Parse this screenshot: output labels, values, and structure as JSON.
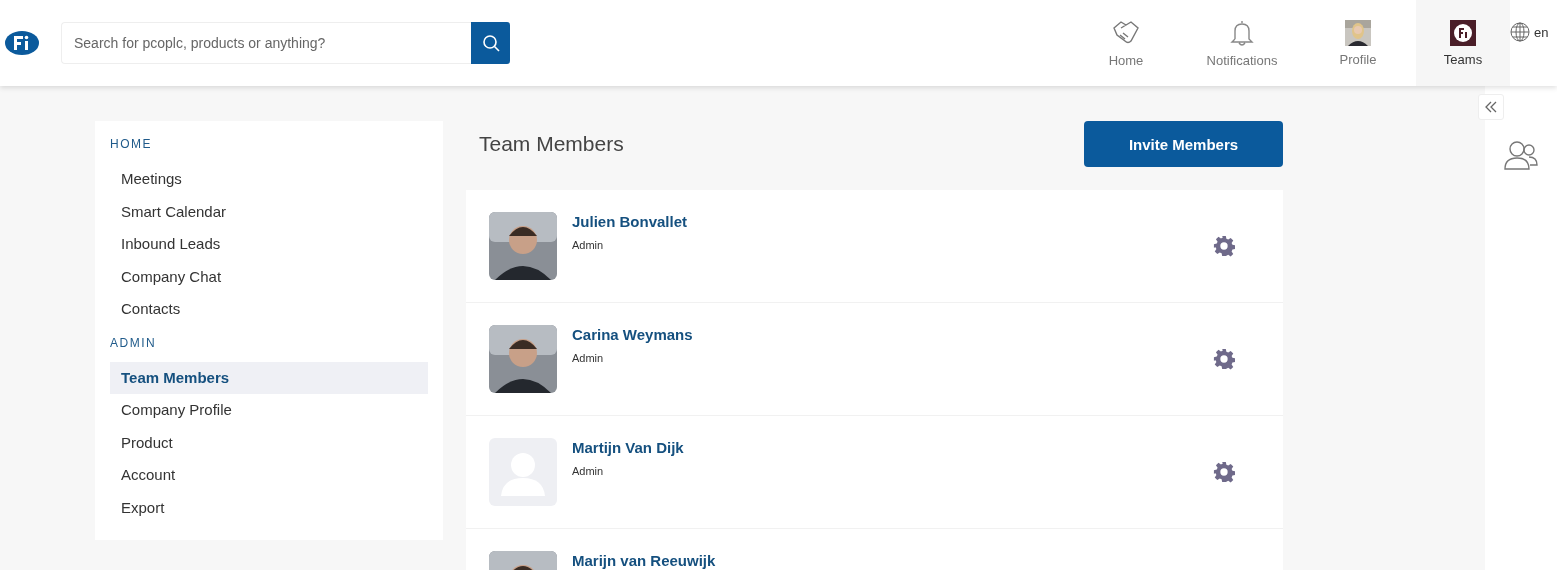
{
  "search": {
    "placeholder": "Search for pcoplc, products or anything?"
  },
  "nav": [
    {
      "label": "Home",
      "kind": "handshake",
      "selected": false
    },
    {
      "label": "Notifications",
      "kind": "bell",
      "selected": false
    },
    {
      "label": "Profile",
      "selected": false
    },
    {
      "label": "Teams",
      "kind": "logo",
      "selected": true
    }
  ],
  "language": "en",
  "sidebar": {
    "sections": [
      {
        "heading": "HOME",
        "items": [
          {
            "label": "Meetings",
            "selected": false
          },
          {
            "label": "Smart Calendar",
            "selected": false
          },
          {
            "label": "Inbound Leads",
            "selected": false
          },
          {
            "label": "Company Chat",
            "selected": false
          },
          {
            "label": "Contacts",
            "selected": false
          }
        ]
      },
      {
        "heading": "ADMIN",
        "items": [
          {
            "label": "Team Members",
            "selected": true
          },
          {
            "label": "Company Profile",
            "selected": false
          },
          {
            "label": "Product",
            "selected": false
          },
          {
            "label": "Account",
            "selected": false
          },
          {
            "label": "Export",
            "selected": false
          }
        ]
      }
    ]
  },
  "page_title": "Team Members",
  "invite_button": "Invite Members",
  "members": [
    {
      "name": "Julien Bonvallet",
      "role": "Admin",
      "kind": "picture"
    },
    {
      "name": "Carina Weymans",
      "role": "Admin",
      "kind": "picture"
    },
    {
      "name": "Martijn Van Dijk",
      "role": "Admin",
      "kind": "placeholder"
    },
    {
      "name": "Marijn van Reeuwijk",
      "kind": "picture"
    }
  ]
}
